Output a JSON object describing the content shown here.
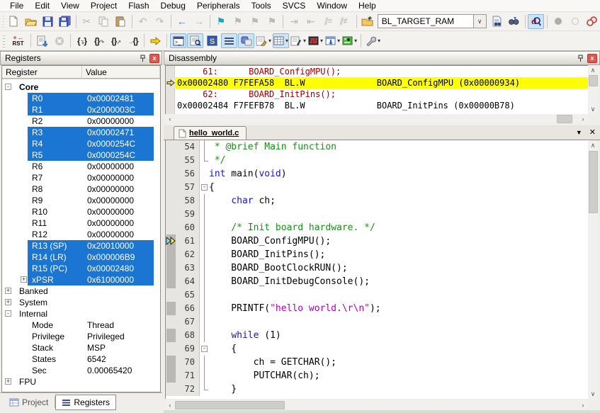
{
  "menu": {
    "items": [
      "File",
      "Edit",
      "View",
      "Project",
      "Flash",
      "Debug",
      "Peripherals",
      "Tools",
      "SVCS",
      "Window",
      "Help"
    ]
  },
  "toolbar": {
    "target": "BL_TARGET_RAM",
    "rst": "RST"
  },
  "registers": {
    "title": "Registers",
    "col_register": "Register",
    "col_value": "Value",
    "rows": [
      {
        "label": "Core",
        "value": "",
        "level": 0,
        "exp": "-",
        "bold": true,
        "sel": false
      },
      {
        "label": "R0",
        "value": "0x00002481",
        "level": 1,
        "sel": true
      },
      {
        "label": "R1",
        "value": "0x2000003C",
        "level": 1,
        "sel": true
      },
      {
        "label": "R2",
        "value": "0x00000000",
        "level": 1,
        "sel": false
      },
      {
        "label": "R3",
        "value": "0x00002471",
        "level": 1,
        "sel": true
      },
      {
        "label": "R4",
        "value": "0x0000254C",
        "level": 1,
        "sel": true
      },
      {
        "label": "R5",
        "value": "0x0000254C",
        "level": 1,
        "sel": true
      },
      {
        "label": "R6",
        "value": "0x00000000",
        "level": 1,
        "sel": false
      },
      {
        "label": "R7",
        "value": "0x00000000",
        "level": 1,
        "sel": false
      },
      {
        "label": "R8",
        "value": "0x00000000",
        "level": 1,
        "sel": false
      },
      {
        "label": "R9",
        "value": "0x00000000",
        "level": 1,
        "sel": false
      },
      {
        "label": "R10",
        "value": "0x00000000",
        "level": 1,
        "sel": false
      },
      {
        "label": "R11",
        "value": "0x00000000",
        "level": 1,
        "sel": false
      },
      {
        "label": "R12",
        "value": "0x00000000",
        "level": 1,
        "sel": false
      },
      {
        "label": "R13 (SP)",
        "value": "0x20010000",
        "level": 1,
        "sel": true
      },
      {
        "label": "R14 (LR)",
        "value": "0x000006B9",
        "level": 1,
        "sel": true
      },
      {
        "label": "R15 (PC)",
        "value": "0x00002480",
        "level": 1,
        "sel": true
      },
      {
        "label": "xPSR",
        "value": "0x61000000",
        "level": 1,
        "exp": "+",
        "sel": true
      },
      {
        "label": "Banked",
        "value": "",
        "level": 0,
        "exp": "+",
        "sel": false
      },
      {
        "label": "System",
        "value": "",
        "level": 0,
        "exp": "+",
        "sel": false
      },
      {
        "label": "Internal",
        "value": "",
        "level": 0,
        "exp": "-",
        "sel": false
      },
      {
        "label": "Mode",
        "value": "Thread",
        "level": 1,
        "sel": false
      },
      {
        "label": "Privilege",
        "value": "Privileged",
        "level": 1,
        "sel": false
      },
      {
        "label": "Stack",
        "value": "MSP",
        "level": 1,
        "sel": false
      },
      {
        "label": "States",
        "value": "6542",
        "level": 1,
        "sel": false
      },
      {
        "label": "Sec",
        "value": "0.00065420",
        "level": 1,
        "sel": false
      },
      {
        "label": "FPU",
        "value": "",
        "level": 0,
        "exp": "+",
        "sel": false
      }
    ]
  },
  "bottom_tabs": {
    "project": "Project",
    "registers": "Registers"
  },
  "disassembly": {
    "title": "Disassembly",
    "rows": [
      {
        "text": "     61:      BOARD_ConfigMPU();",
        "kind": "source",
        "current": false
      },
      {
        "text": "0x00002480 F7FEFA58  BL.W              BOARD_ConfigMPU (0x00000934)",
        "kind": "inst",
        "current": true
      },
      {
        "text": "     62:      BOARD_InitPins();",
        "kind": "source",
        "current": false
      },
      {
        "text": "0x00002484 F7FEFB78  BL.W              BOARD_InitPins (0x00000B78)",
        "kind": "inst",
        "current": false
      }
    ]
  },
  "editor": {
    "tab": "hello_world.c",
    "lines": [
      {
        "n": 54,
        "fold": "bar",
        "block": false,
        "marker": false,
        "seg": [
          [
            " * @brief Main function",
            "com"
          ]
        ]
      },
      {
        "n": 55,
        "fold": "end",
        "block": false,
        "marker": false,
        "seg": [
          [
            " */",
            "com"
          ]
        ]
      },
      {
        "n": 56,
        "fold": "",
        "block": false,
        "marker": false,
        "seg": [
          [
            "int",
            "kw"
          ],
          [
            " main(",
            ""
          ],
          [
            "void",
            "kw"
          ],
          [
            ")",
            ""
          ]
        ]
      },
      {
        "n": 57,
        "fold": "box",
        "block": false,
        "marker": false,
        "seg": [
          [
            "{",
            ""
          ]
        ]
      },
      {
        "n": 58,
        "fold": "bar",
        "block": false,
        "marker": false,
        "seg": [
          [
            "    ",
            ""
          ],
          [
            "char",
            "kw"
          ],
          [
            " ch;",
            ""
          ]
        ]
      },
      {
        "n": 59,
        "fold": "bar",
        "block": false,
        "marker": false,
        "seg": []
      },
      {
        "n": 60,
        "fold": "bar",
        "block": false,
        "marker": false,
        "seg": [
          [
            "    ",
            ""
          ],
          [
            "/* Init board hardware. */",
            "com"
          ]
        ]
      },
      {
        "n": 61,
        "fold": "bar",
        "block": true,
        "marker": true,
        "seg": [
          [
            "    BOARD_ConfigMPU();",
            ""
          ]
        ]
      },
      {
        "n": 62,
        "fold": "bar",
        "block": true,
        "marker": false,
        "seg": [
          [
            "    BOARD_InitPins();",
            ""
          ]
        ]
      },
      {
        "n": 63,
        "fold": "bar",
        "block": true,
        "marker": false,
        "seg": [
          [
            "    BOARD_BootClockRUN();",
            ""
          ]
        ]
      },
      {
        "n": 64,
        "fold": "bar",
        "block": true,
        "marker": false,
        "seg": [
          [
            "    BOARD_InitDebugConsole();",
            ""
          ]
        ]
      },
      {
        "n": 65,
        "fold": "bar",
        "block": false,
        "marker": false,
        "seg": []
      },
      {
        "n": 66,
        "fold": "bar",
        "block": true,
        "marker": false,
        "seg": [
          [
            "    PRINTF(",
            ""
          ],
          [
            "\"hello world.\\r\\n\"",
            "str"
          ],
          [
            ");",
            ""
          ]
        ]
      },
      {
        "n": 67,
        "fold": "bar",
        "block": false,
        "marker": false,
        "seg": []
      },
      {
        "n": 68,
        "fold": "bar",
        "block": true,
        "marker": false,
        "seg": [
          [
            "    ",
            ""
          ],
          [
            "while",
            "kw"
          ],
          [
            " (1)",
            ""
          ]
        ]
      },
      {
        "n": 69,
        "fold": "box",
        "block": false,
        "marker": false,
        "seg": [
          [
            "    {",
            ""
          ]
        ]
      },
      {
        "n": 70,
        "fold": "bar",
        "block": true,
        "marker": false,
        "seg": [
          [
            "        ch = GETCHAR();",
            ""
          ]
        ]
      },
      {
        "n": 71,
        "fold": "bar",
        "block": true,
        "marker": false,
        "seg": [
          [
            "        PUTCHAR(ch);",
            ""
          ]
        ]
      },
      {
        "n": 72,
        "fold": "end",
        "block": false,
        "marker": false,
        "seg": [
          [
            "    }",
            ""
          ]
        ]
      }
    ]
  },
  "colors": {
    "selection_blue": "#1b75d2",
    "current_line_yellow": "#ffff00",
    "disasm_source_red": "#a00000",
    "keyword_blue": "#1616d1",
    "comment_green": "#149114",
    "string_magenta": "#b400b4"
  }
}
